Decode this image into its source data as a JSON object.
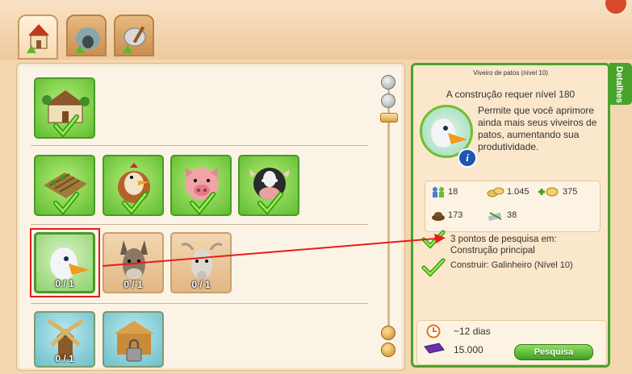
{
  "tabs": [
    {
      "icon": "farm-buildings-icon"
    },
    {
      "icon": "cave-icon"
    },
    {
      "icon": "workshop-tools-icon"
    }
  ],
  "grid": {
    "row1": [
      {
        "icon": "farmhouse-icon",
        "status": "done"
      }
    ],
    "row2": [
      {
        "icon": "crop-field-icon",
        "status": "done"
      },
      {
        "icon": "chicken-icon",
        "status": "done"
      },
      {
        "icon": "pig-icon",
        "status": "done"
      },
      {
        "icon": "cow-icon",
        "status": "done"
      }
    ],
    "row3": [
      {
        "icon": "duck-icon",
        "count": "0 / 1"
      },
      {
        "icon": "donkey-icon",
        "count": "0 / 1"
      },
      {
        "icon": "goat-icon",
        "count": "0 / 1"
      }
    ],
    "row4": [
      {
        "icon": "windmill-icon",
        "count": "0 / 1"
      },
      {
        "icon": "locked-barn-icon"
      }
    ]
  },
  "details": {
    "tab_label": "Detalhes",
    "title": "Viveiro de patos (nível 10)",
    "requirement": "A construção requer nível 180",
    "description": "Permite que você aprimore ainda mais seus viveiros de patos, aumentando sua produtividade.",
    "stats": {
      "workers": "18",
      "coins": "1.045",
      "plus_coins": "375",
      "manure": "173",
      "materials": "38"
    },
    "requirements": [
      "3 pontos de pesquisa em: Construção principal",
      "Construir: Galinheiro (Nível 10)"
    ],
    "time": "~12 dias",
    "cost": "15.000",
    "research_button": "Pesquisa"
  },
  "colors": {
    "accent_green": "#4aa22d",
    "highlight_red": "#e51c1c"
  }
}
